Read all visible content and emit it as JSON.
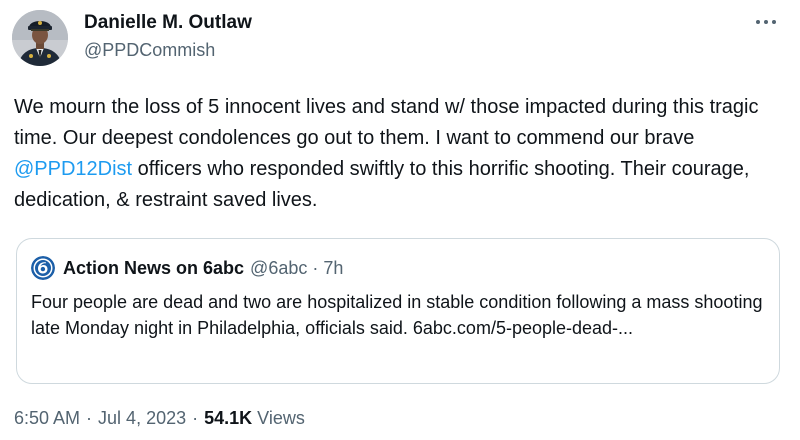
{
  "author": {
    "name": "Danielle M. Outlaw",
    "handle": "@PPDCommish",
    "avatar_icon": "profile-photo-uniformed-officer"
  },
  "more_icon": "more-horizontal-icon",
  "tweet": {
    "text_part1": "We mourn the loss of 5 innocent lives and stand w/ those impacted during this tragic time. Our deepest condolences go out to them. I want to commend our brave ",
    "mention": "@PPD12Dist",
    "text_part2": " officers who responded swiftly to this horrific shooting. Their courage, dedication, & restraint saved lives."
  },
  "quote": {
    "avatar_icon": "6abc-logo",
    "name": "Action News on 6abc",
    "handle": "@6abc",
    "separator": "·",
    "time": "7h",
    "text": "Four people are dead and two are hospitalized in stable condition following a mass shooting late Monday night in Philadelphia, officials said.  6abc.com/5-people-dead-..."
  },
  "meta": {
    "time": "6:50 AM",
    "separator": "·",
    "date": "Jul 4, 2023",
    "views_count": "54.1K",
    "views_label": "Views"
  },
  "colors": {
    "link": "#1d9bf0",
    "secondary_text": "#536471",
    "border": "#cfd9de",
    "logo_blue": "#1c5fa8"
  }
}
